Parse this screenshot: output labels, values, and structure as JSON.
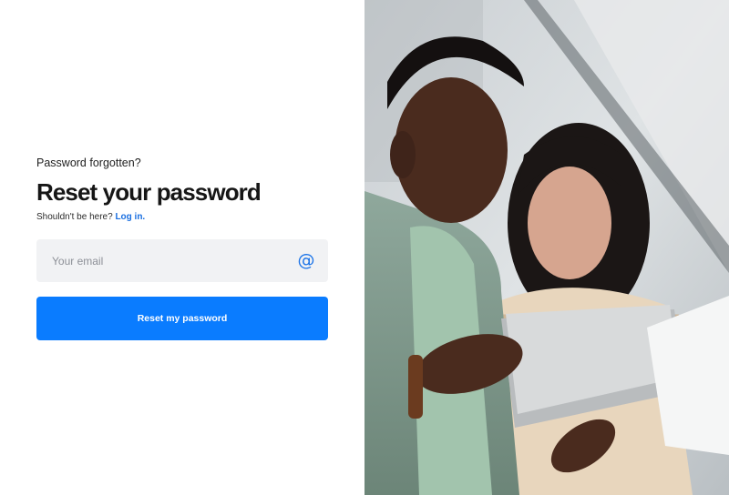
{
  "form": {
    "eyebrow": "Password forgotten?",
    "title": "Reset your password",
    "subtitle_prefix": "Shouldn't be here?",
    "login_link": "Log in.",
    "email": {
      "placeholder": "Your email",
      "value": "",
      "icon": "at-icon"
    },
    "submit_label": "Reset my password"
  },
  "colors": {
    "accent": "#0a7cff",
    "link": "#1a6fe0",
    "input_bg": "#f1f2f4"
  }
}
